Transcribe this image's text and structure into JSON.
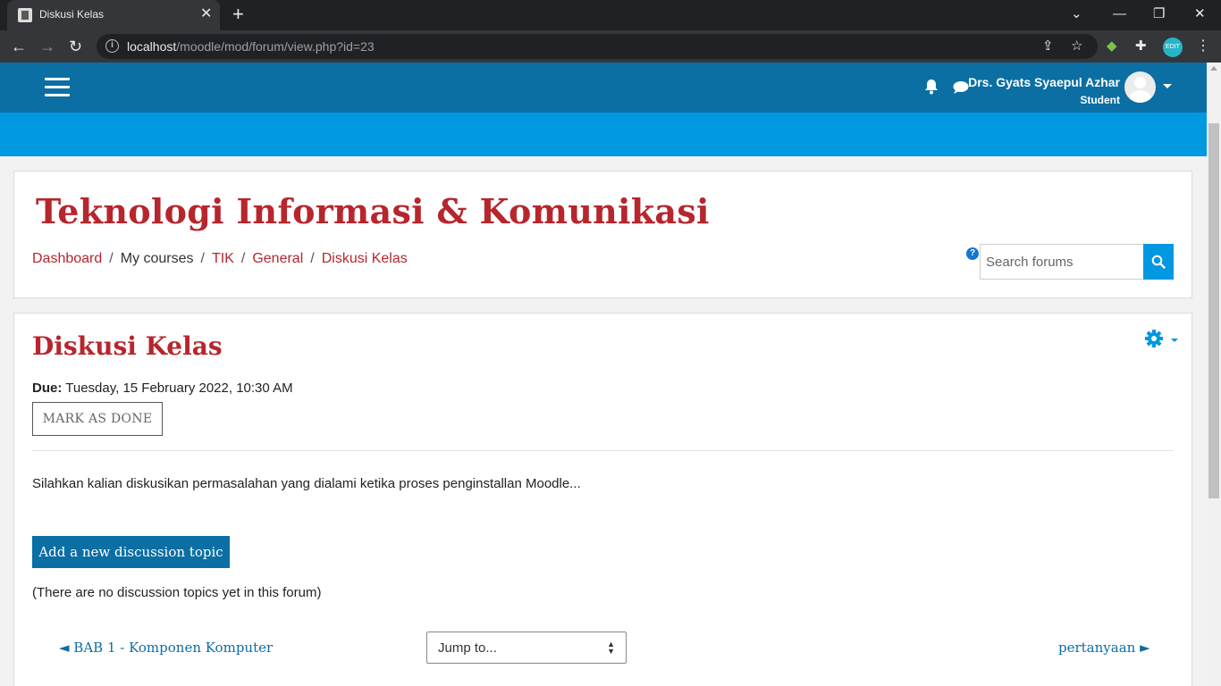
{
  "browser": {
    "tab_title": "Diskusi Kelas",
    "url_host": "localhost",
    "url_path": "/moodle/mod/forum/view.php?id=23",
    "profile_badge": "EDIT"
  },
  "navbar": {
    "user_name": "Drs. Gyats Syaepul Azhar",
    "user_role": "Student"
  },
  "header": {
    "course_title": "Teknologi Informasi & Komunikasi",
    "breadcrumb": [
      "Dashboard",
      "My courses",
      "TIK",
      "General",
      "Diskusi Kelas"
    ],
    "search_placeholder": "Search forums"
  },
  "forum": {
    "title": "Diskusi Kelas",
    "due_label": "Due:",
    "due_value": "Tuesday, 15 February 2022, 10:30 AM",
    "mark_done_label": "MARK AS DONE",
    "intro": "Silahkan kalian diskusikan permasalahan yang dialami ketika proses penginstallan Moodle...",
    "add_topic_label": "Add a new discussion topic",
    "no_topics_text": "(There are no discussion topics yet in this forum)"
  },
  "activity_nav": {
    "prev_label": "◄ BAB 1 - Komponen Komputer",
    "jump_label": "Jump to...",
    "next_label": "pertanyaan ►"
  },
  "colors": {
    "navbar": "#0b6fa3",
    "banner": "#0098e0",
    "title_red": "#b7262d"
  }
}
